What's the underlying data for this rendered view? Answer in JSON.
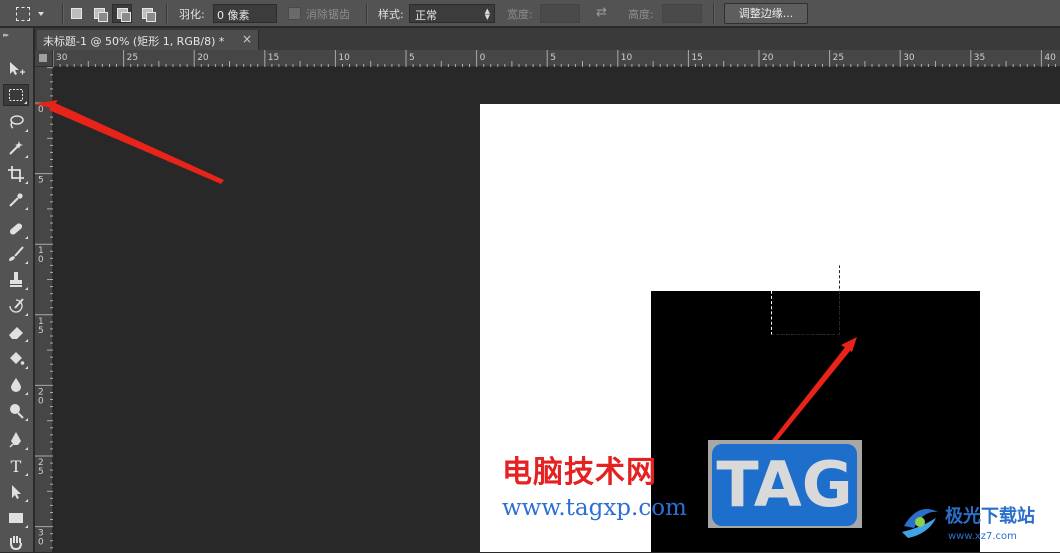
{
  "options_bar": {
    "feather_label": "羽化:",
    "feather_value": "0 像素",
    "anti_alias_label": "消除锯齿",
    "style_label": "样式:",
    "style_value": "正常",
    "width_label": "宽度:",
    "height_label": "高度:",
    "refine_edge_label": "调整边缘..."
  },
  "document_tab": {
    "title": "未标题-1 @ 50% (矩形 1, RGB/8) *",
    "close_symbol": "×"
  },
  "ruler_h_labels": [
    "30",
    "25",
    "20",
    "15",
    "10",
    "5",
    "0",
    "5",
    "10",
    "15",
    "20",
    "25",
    "30",
    "35",
    "40"
  ],
  "ruler_v_labels": [
    "0",
    "5",
    "10",
    "15",
    "20",
    "25",
    "30"
  ],
  "toolbar": {
    "tools": [
      "move-tool",
      "rectangular-marquee-tool",
      "lasso-tool",
      "magic-wand-tool",
      "crop-tool",
      "eyedropper-tool",
      "healing-brush-tool",
      "brush-tool",
      "clone-stamp-tool",
      "history-brush-tool",
      "eraser-tool",
      "paint-bucket-tool",
      "blur-tool",
      "dodge-tool",
      "pen-tool",
      "type-tool",
      "path-selection-tool",
      "rectangle-tool",
      "hand-tool"
    ],
    "type_tool_glyph": "T",
    "active_tool": "rectangular-marquee-tool"
  },
  "watermark": {
    "site_name_cn": "电脑技术网",
    "site_url": "www.tagxp.com",
    "tag_text": "TAG",
    "logo_text": "极光下载站",
    "logo_url": "www.xz7.com"
  },
  "colors": {
    "arrow": "#e8231a",
    "canvas": "#ffffff",
    "shape": "#000000",
    "workspace": "#282828"
  }
}
